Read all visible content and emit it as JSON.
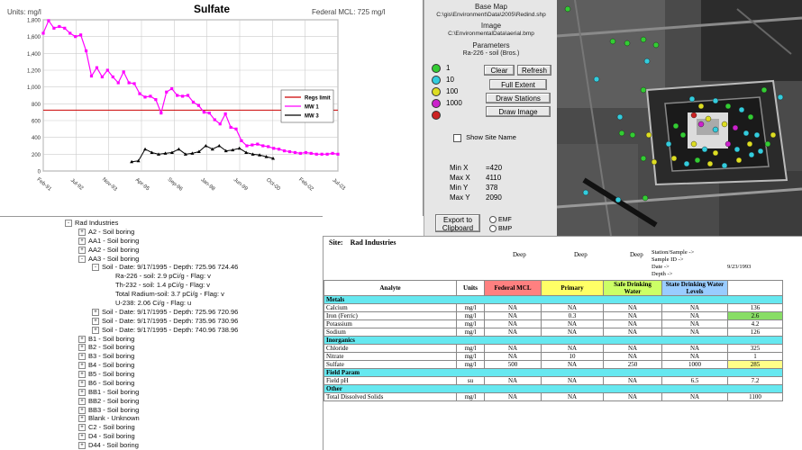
{
  "chart": {
    "title": "Sulfate",
    "units_label": "Units: mg/l",
    "mcl_label": "Federal MCL: 725 mg/l",
    "y_ticks": [
      "1,800",
      "1,600",
      "1,400",
      "1,200",
      "1,000",
      "800",
      "600",
      "400",
      "200",
      "0"
    ],
    "x_ticks": [
      "Feb-91",
      "Jul-92",
      "Nov-93",
      "Apr-95",
      "Sep-96",
      "Jan-98",
      "Jun-99",
      "Oct-00",
      "Feb-02",
      "Jul-03"
    ],
    "legend": [
      "Regs limit",
      "MW 1",
      "MW 3"
    ]
  },
  "chart_data": {
    "type": "line",
    "title": "Sulfate",
    "ylabel": "Units: mg/l",
    "ylim": [
      0,
      1800
    ],
    "categories": [
      "Feb-91",
      "Jul-92",
      "Nov-93",
      "Apr-95",
      "Sep-96",
      "Jan-98",
      "Jun-99",
      "Oct-00",
      "Feb-02",
      "Jul-03"
    ],
    "series": [
      {
        "name": "Regs limit",
        "color": "#cc0000",
        "values": [
          725,
          725
        ]
      },
      {
        "name": "MW 1",
        "color": "#ff00ff",
        "values": [
          1640,
          1790,
          1700,
          1720,
          1700,
          1640,
          1600,
          1620,
          1430,
          1130,
          1230,
          1120,
          1200,
          1120,
          1050,
          1180,
          1050,
          1040,
          920,
          880,
          890,
          850,
          690,
          940,
          980,
          900,
          890,
          900,
          820,
          780,
          700,
          690,
          610,
          560,
          680,
          520,
          500,
          360,
          300,
          310,
          320,
          300,
          290,
          270,
          260,
          240,
          230,
          220,
          210,
          220,
          210,
          200,
          200,
          200,
          210,
          200
        ]
      },
      {
        "name": "MW 3",
        "color": "#000000",
        "values": [
          110,
          120,
          260,
          220,
          200,
          210,
          220,
          260,
          200,
          210,
          230,
          300,
          260,
          300,
          240,
          250,
          270,
          220,
          200,
          190,
          170,
          150
        ]
      }
    ]
  },
  "controls": {
    "base_map_label": "Base Map",
    "base_map_path": "C:\\gis\\Environment\\Data\\2005\\Redind.shp",
    "image_label": "Image",
    "image_path": "C:\\EnvironmentalData\\aerial.bmp",
    "parameters_label": "Parameters",
    "parameters_value": "Ra-226 - soil (Bros.)",
    "legend": [
      {
        "label": "1",
        "color": "#33cc33"
      },
      {
        "label": "10",
        "color": "#33ccdd"
      },
      {
        "label": "100",
        "color": "#dddd22"
      },
      {
        "label": "1000",
        "color": "#cc22cc"
      },
      {
        "label": "",
        "color": "#cc2222"
      }
    ],
    "buttons": {
      "clear": "Clear",
      "refresh": "Refresh",
      "full_extent": "Full Extent",
      "draw_stations": "Draw Stations",
      "draw_image": "Draw Image",
      "export": "Export to Clipboard"
    },
    "show_site_name": "Show Site Name",
    "stats": [
      {
        "label": "Min X",
        "value": "=420"
      },
      {
        "label": "Max X",
        "value": "4110"
      },
      {
        "label": "Min Y",
        "value": "378"
      },
      {
        "label": "Max Y",
        "value": "2090"
      }
    ],
    "radio_emf": "EMF",
    "radio_bmp": "BMP"
  },
  "tree": {
    "items": [
      {
        "label": "Rad Industries",
        "indent": 0,
        "toggle": "-"
      },
      {
        "label": "A2 - Soil boring",
        "indent": 1,
        "toggle": "+"
      },
      {
        "label": "AA1 - Soil boring",
        "indent": 1,
        "toggle": "+"
      },
      {
        "label": "AA2 - Soil boring",
        "indent": 1,
        "toggle": "+"
      },
      {
        "label": "AA3 - Soil boring",
        "indent": 1,
        "toggle": "-"
      },
      {
        "label": "Soil - Date: 9/17/1995 - Depth: 725.96 724.46",
        "indent": 2,
        "toggle": "-"
      },
      {
        "label": "Ra-226 - soil: 2.9 pCi/g - Flag: v",
        "indent": 3,
        "toggle": ""
      },
      {
        "label": "Th-232 - soil: 1.4 pCi/g - Flag: v",
        "indent": 3,
        "toggle": ""
      },
      {
        "label": "Total Radium-soil: 3.7 pCi/g - Flag: v",
        "indent": 3,
        "toggle": ""
      },
      {
        "label": "U-238: 2.06 Ci/g - Flag: u",
        "indent": 3,
        "toggle": ""
      },
      {
        "label": "Soil - Date: 9/17/1995 - Depth: 725.96 720.96",
        "indent": 2,
        "toggle": "+"
      },
      {
        "label": "Soil - Date: 9/17/1995 - Depth: 735.96 730.96",
        "indent": 2,
        "toggle": "+"
      },
      {
        "label": "Soil - Date: 9/17/1995 - Depth: 740.96 738.96",
        "indent": 2,
        "toggle": "+"
      },
      {
        "label": "B1 - Soil boring",
        "indent": 1,
        "toggle": "+"
      },
      {
        "label": "B2 - Soil boring",
        "indent": 1,
        "toggle": "+"
      },
      {
        "label": "B3 - Soil boring",
        "indent": 1,
        "toggle": "+"
      },
      {
        "label": "B4 - Soil boring",
        "indent": 1,
        "toggle": "+"
      },
      {
        "label": "B5 - Soil boring",
        "indent": 1,
        "toggle": "+"
      },
      {
        "label": "B6 - Soil boring",
        "indent": 1,
        "toggle": "+"
      },
      {
        "label": "BB1 - Soil boring",
        "indent": 1,
        "toggle": "+"
      },
      {
        "label": "BB2 - Soil boring",
        "indent": 1,
        "toggle": "+"
      },
      {
        "label": "BB3 - Soil boring",
        "indent": 1,
        "toggle": "+"
      },
      {
        "label": "Blank - Unknown",
        "indent": 1,
        "toggle": "+"
      },
      {
        "label": "C2 - Soil boring",
        "indent": 1,
        "toggle": "+"
      },
      {
        "label": "D4 - Soil boring",
        "indent": 1,
        "toggle": "+"
      },
      {
        "label": "D44 - Soil boring",
        "indent": 1,
        "toggle": "+"
      }
    ]
  },
  "table": {
    "site_label": "Site:",
    "site_value": "Rad Industries",
    "depth_labels": [
      "Deep",
      "Deep",
      "Deep"
    ],
    "meta_labels": [
      "Station/Sample ->",
      "Sample ID ->",
      "Date ->",
      "Depth ->"
    ],
    "meta_value": "9/23/1993",
    "headers": [
      "Analyte",
      "Units",
      "Federal MCL",
      "Primary",
      "Safe Drinking Water",
      "State Drinking Water Levels",
      ""
    ],
    "header_colors": [
      "#ffffff",
      "#ffffff",
      "#ff8080",
      "#ffff66",
      "#ccff66",
      "#99ccff",
      "#ffffff"
    ],
    "rows": [
      {
        "section": "Metals"
      },
      {
        "cells": [
          "Calcium",
          "mg/l",
          "NA",
          "NA",
          "NA",
          "NA",
          "136"
        ]
      },
      {
        "cells": [
          "Iron (Ferric)",
          "mg/l",
          "NA",
          "0.3",
          "NA",
          "NA",
          "2.6"
        ],
        "hl": "#88dd66"
      },
      {
        "cells": [
          "Potassium",
          "mg/l",
          "NA",
          "NA",
          "NA",
          "NA",
          "4.2"
        ]
      },
      {
        "cells": [
          "Sodium",
          "mg/l",
          "NA",
          "NA",
          "NA",
          "NA",
          "126"
        ]
      },
      {
        "section": "Inorganics"
      },
      {
        "cells": [
          "Chloride",
          "mg/l",
          "NA",
          "NA",
          "NA",
          "NA",
          "325"
        ]
      },
      {
        "cells": [
          "Nitrate",
          "mg/l",
          "NA",
          "10",
          "NA",
          "NA",
          "1"
        ]
      },
      {
        "cells": [
          "Sulfate",
          "mg/l",
          "500",
          "NA",
          "250",
          "1000",
          "285"
        ],
        "hl": "#ffff88"
      },
      {
        "section": "Field Param"
      },
      {
        "cells": [
          "Field pH",
          "su",
          "NA",
          "NA",
          "NA",
          "6.5",
          "7.2"
        ]
      },
      {
        "section": "Other"
      },
      {
        "cells": [
          "Total Dissolved Solids",
          "mg/l",
          "NA",
          "NA",
          "NA",
          "NA",
          "1100"
        ]
      }
    ]
  }
}
